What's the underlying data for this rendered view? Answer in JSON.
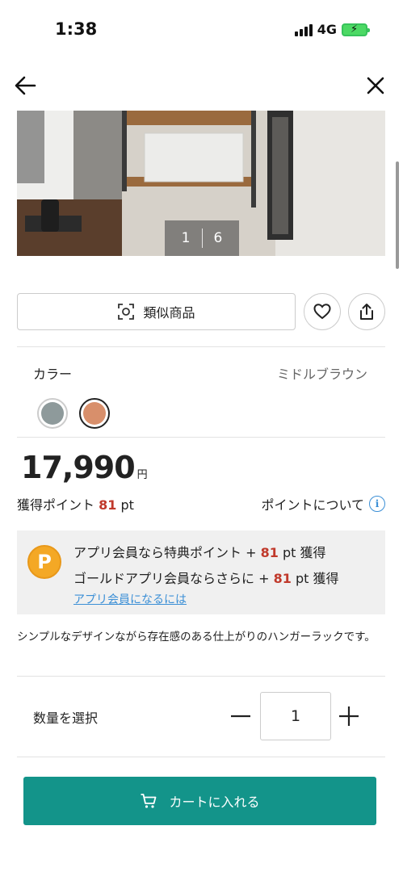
{
  "status_bar": {
    "time": "1:38",
    "network": "4G"
  },
  "gallery": {
    "current": "1",
    "total": "6"
  },
  "actions": {
    "similar_label": "類似商品"
  },
  "color": {
    "label": "カラー",
    "selected_name": "ミドルブラウン",
    "swatches": [
      "#8e9a9b",
      "#d88f6b"
    ]
  },
  "price": {
    "amount": "17,990",
    "currency": "円"
  },
  "points": {
    "label": "獲得ポイント",
    "value": "81",
    "unit": "pt",
    "about_label": "ポイントについて"
  },
  "promo": {
    "badge": "P",
    "line1_prefix": "アプリ会員なら特典ポイント +",
    "line1_value": "81",
    "line1_suffix": "pt 獲得",
    "line2_prefix": "ゴールドアプリ会員ならさらに +",
    "line2_value": "81",
    "line2_suffix": "pt 獲得",
    "link": "アプリ会員になるには"
  },
  "description": "シンプルなデザインながら存在感のある仕上がりのハンガーラックです。",
  "quantity": {
    "label": "数量を選択",
    "value": "1"
  },
  "cart": {
    "label": "カートに入れる"
  },
  "colors": {
    "accent": "#13948a",
    "point_red": "#c0392b",
    "link_blue": "#3b8fd6",
    "badge_gold": "#f4a825"
  }
}
